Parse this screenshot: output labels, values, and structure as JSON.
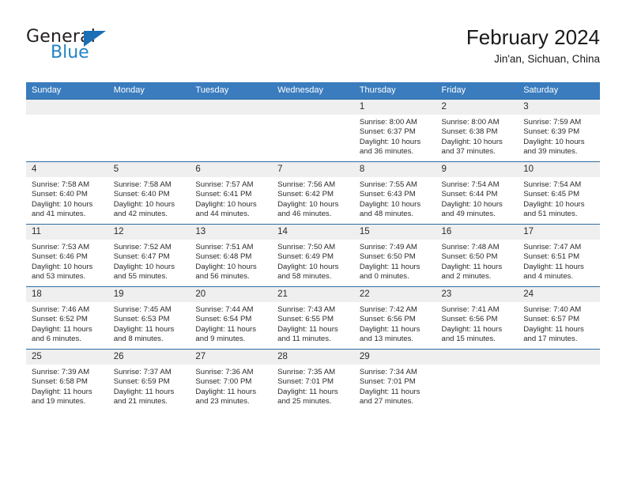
{
  "brand": {
    "name_top": "General",
    "name_bottom": "Blue",
    "triangle_color": "#1a6fb5",
    "blue_color": "#2484c6"
  },
  "header": {
    "title": "February 2024",
    "subtitle": "Jin'an, Sichuan, China"
  },
  "theme": {
    "header_bg": "#3a7cbe",
    "row_border": "#2e6da4",
    "daynum_bg": "#efefef"
  },
  "weekdays": [
    "Sunday",
    "Monday",
    "Tuesday",
    "Wednesday",
    "Thursday",
    "Friday",
    "Saturday"
  ],
  "weeks": [
    [
      {
        "day": "",
        "empty": true
      },
      {
        "day": "",
        "empty": true
      },
      {
        "day": "",
        "empty": true
      },
      {
        "day": "",
        "empty": true
      },
      {
        "day": "1",
        "sunrise": "Sunrise: 8:00 AM",
        "sunset": "Sunset: 6:37 PM",
        "daylight_1": "Daylight: 10 hours",
        "daylight_2": "and 36 minutes."
      },
      {
        "day": "2",
        "sunrise": "Sunrise: 8:00 AM",
        "sunset": "Sunset: 6:38 PM",
        "daylight_1": "Daylight: 10 hours",
        "daylight_2": "and 37 minutes."
      },
      {
        "day": "3",
        "sunrise": "Sunrise: 7:59 AM",
        "sunset": "Sunset: 6:39 PM",
        "daylight_1": "Daylight: 10 hours",
        "daylight_2": "and 39 minutes."
      }
    ],
    [
      {
        "day": "4",
        "sunrise": "Sunrise: 7:58 AM",
        "sunset": "Sunset: 6:40 PM",
        "daylight_1": "Daylight: 10 hours",
        "daylight_2": "and 41 minutes."
      },
      {
        "day": "5",
        "sunrise": "Sunrise: 7:58 AM",
        "sunset": "Sunset: 6:40 PM",
        "daylight_1": "Daylight: 10 hours",
        "daylight_2": "and 42 minutes."
      },
      {
        "day": "6",
        "sunrise": "Sunrise: 7:57 AM",
        "sunset": "Sunset: 6:41 PM",
        "daylight_1": "Daylight: 10 hours",
        "daylight_2": "and 44 minutes."
      },
      {
        "day": "7",
        "sunrise": "Sunrise: 7:56 AM",
        "sunset": "Sunset: 6:42 PM",
        "daylight_1": "Daylight: 10 hours",
        "daylight_2": "and 46 minutes."
      },
      {
        "day": "8",
        "sunrise": "Sunrise: 7:55 AM",
        "sunset": "Sunset: 6:43 PM",
        "daylight_1": "Daylight: 10 hours",
        "daylight_2": "and 48 minutes."
      },
      {
        "day": "9",
        "sunrise": "Sunrise: 7:54 AM",
        "sunset": "Sunset: 6:44 PM",
        "daylight_1": "Daylight: 10 hours",
        "daylight_2": "and 49 minutes."
      },
      {
        "day": "10",
        "sunrise": "Sunrise: 7:54 AM",
        "sunset": "Sunset: 6:45 PM",
        "daylight_1": "Daylight: 10 hours",
        "daylight_2": "and 51 minutes."
      }
    ],
    [
      {
        "day": "11",
        "sunrise": "Sunrise: 7:53 AM",
        "sunset": "Sunset: 6:46 PM",
        "daylight_1": "Daylight: 10 hours",
        "daylight_2": "and 53 minutes."
      },
      {
        "day": "12",
        "sunrise": "Sunrise: 7:52 AM",
        "sunset": "Sunset: 6:47 PM",
        "daylight_1": "Daylight: 10 hours",
        "daylight_2": "and 55 minutes."
      },
      {
        "day": "13",
        "sunrise": "Sunrise: 7:51 AM",
        "sunset": "Sunset: 6:48 PM",
        "daylight_1": "Daylight: 10 hours",
        "daylight_2": "and 56 minutes."
      },
      {
        "day": "14",
        "sunrise": "Sunrise: 7:50 AM",
        "sunset": "Sunset: 6:49 PM",
        "daylight_1": "Daylight: 10 hours",
        "daylight_2": "and 58 minutes."
      },
      {
        "day": "15",
        "sunrise": "Sunrise: 7:49 AM",
        "sunset": "Sunset: 6:50 PM",
        "daylight_1": "Daylight: 11 hours",
        "daylight_2": "and 0 minutes."
      },
      {
        "day": "16",
        "sunrise": "Sunrise: 7:48 AM",
        "sunset": "Sunset: 6:50 PM",
        "daylight_1": "Daylight: 11 hours",
        "daylight_2": "and 2 minutes."
      },
      {
        "day": "17",
        "sunrise": "Sunrise: 7:47 AM",
        "sunset": "Sunset: 6:51 PM",
        "daylight_1": "Daylight: 11 hours",
        "daylight_2": "and 4 minutes."
      }
    ],
    [
      {
        "day": "18",
        "sunrise": "Sunrise: 7:46 AM",
        "sunset": "Sunset: 6:52 PM",
        "daylight_1": "Daylight: 11 hours",
        "daylight_2": "and 6 minutes."
      },
      {
        "day": "19",
        "sunrise": "Sunrise: 7:45 AM",
        "sunset": "Sunset: 6:53 PM",
        "daylight_1": "Daylight: 11 hours",
        "daylight_2": "and 8 minutes."
      },
      {
        "day": "20",
        "sunrise": "Sunrise: 7:44 AM",
        "sunset": "Sunset: 6:54 PM",
        "daylight_1": "Daylight: 11 hours",
        "daylight_2": "and 9 minutes."
      },
      {
        "day": "21",
        "sunrise": "Sunrise: 7:43 AM",
        "sunset": "Sunset: 6:55 PM",
        "daylight_1": "Daylight: 11 hours",
        "daylight_2": "and 11 minutes."
      },
      {
        "day": "22",
        "sunrise": "Sunrise: 7:42 AM",
        "sunset": "Sunset: 6:56 PM",
        "daylight_1": "Daylight: 11 hours",
        "daylight_2": "and 13 minutes."
      },
      {
        "day": "23",
        "sunrise": "Sunrise: 7:41 AM",
        "sunset": "Sunset: 6:56 PM",
        "daylight_1": "Daylight: 11 hours",
        "daylight_2": "and 15 minutes."
      },
      {
        "day": "24",
        "sunrise": "Sunrise: 7:40 AM",
        "sunset": "Sunset: 6:57 PM",
        "daylight_1": "Daylight: 11 hours",
        "daylight_2": "and 17 minutes."
      }
    ],
    [
      {
        "day": "25",
        "sunrise": "Sunrise: 7:39 AM",
        "sunset": "Sunset: 6:58 PM",
        "daylight_1": "Daylight: 11 hours",
        "daylight_2": "and 19 minutes."
      },
      {
        "day": "26",
        "sunrise": "Sunrise: 7:37 AM",
        "sunset": "Sunset: 6:59 PM",
        "daylight_1": "Daylight: 11 hours",
        "daylight_2": "and 21 minutes."
      },
      {
        "day": "27",
        "sunrise": "Sunrise: 7:36 AM",
        "sunset": "Sunset: 7:00 PM",
        "daylight_1": "Daylight: 11 hours",
        "daylight_2": "and 23 minutes."
      },
      {
        "day": "28",
        "sunrise": "Sunrise: 7:35 AM",
        "sunset": "Sunset: 7:01 PM",
        "daylight_1": "Daylight: 11 hours",
        "daylight_2": "and 25 minutes."
      },
      {
        "day": "29",
        "sunrise": "Sunrise: 7:34 AM",
        "sunset": "Sunset: 7:01 PM",
        "daylight_1": "Daylight: 11 hours",
        "daylight_2": "and 27 minutes."
      },
      {
        "day": "",
        "empty": true
      },
      {
        "day": "",
        "empty": true
      }
    ]
  ]
}
